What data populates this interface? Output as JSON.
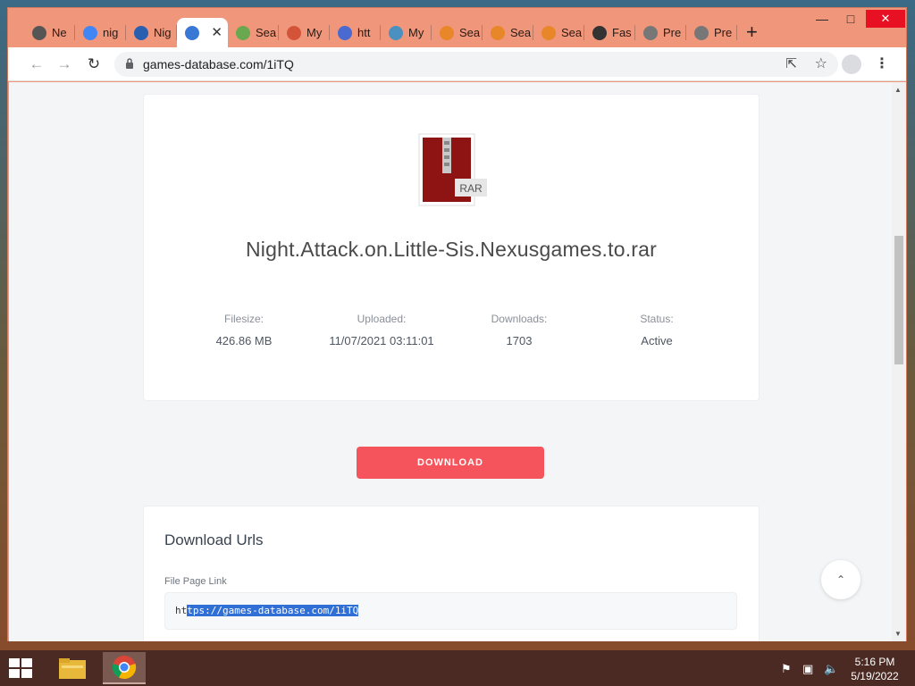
{
  "browser": {
    "tabs": [
      {
        "label": "Ne",
        "icon": "chrome-icon",
        "color": "#555555"
      },
      {
        "label": "nig",
        "icon": "google-icon",
        "color": "#4285f4"
      },
      {
        "label": "Nig",
        "icon": "ng-icon",
        "color": "#2a5fb0"
      },
      {
        "label": "",
        "icon": "cloud-upload-icon",
        "color": "#3a78d6",
        "active": true
      },
      {
        "label": "Sea",
        "icon": "globe-icon",
        "color": "#6aa84f"
      },
      {
        "label": "My",
        "icon": "site-icon",
        "color": "#d4543a"
      },
      {
        "label": "htt",
        "icon": "dot-icon",
        "color": "#4a6ad0"
      },
      {
        "label": "My",
        "icon": "cross-icon",
        "color": "#4a90c0"
      },
      {
        "label": "Sea",
        "icon": "pin-icon",
        "color": "#e8862a"
      },
      {
        "label": "Sea",
        "icon": "pin-icon",
        "color": "#e8862a"
      },
      {
        "label": "Sea",
        "icon": "pin-icon",
        "color": "#e8862a"
      },
      {
        "label": "Fas",
        "icon": "feather-icon",
        "color": "#333333"
      },
      {
        "label": "Pre",
        "icon": "globe-icon",
        "color": "#777777"
      },
      {
        "label": "Pre",
        "icon": "globe-icon",
        "color": "#777777"
      }
    ],
    "url": "games-database.com/1iTQ"
  },
  "file": {
    "icon_badge": "RAR",
    "name": "Night.Attack.on.Little-Sis.Nexusgames.to.rar",
    "stats": [
      {
        "label": "Filesize:",
        "value": "426.86 MB"
      },
      {
        "label": "Uploaded:",
        "value": "11/07/2021 03:11:01"
      },
      {
        "label": "Downloads:",
        "value": "1703"
      },
      {
        "label": "Status:",
        "value": "Active"
      }
    ]
  },
  "download_button": "DOWNLOAD",
  "download_urls": {
    "title": "Download Urls",
    "file_page_label": "File Page Link",
    "link_prefix": "ht",
    "link_selected": "tps://games-database.com/1iTQ"
  },
  "taskbar": {
    "time": "5:16 PM",
    "date": "5/19/2022"
  },
  "colors": {
    "frame": "#f0967a",
    "download_button": "#f5545c",
    "selection": "#2f6fd6"
  }
}
